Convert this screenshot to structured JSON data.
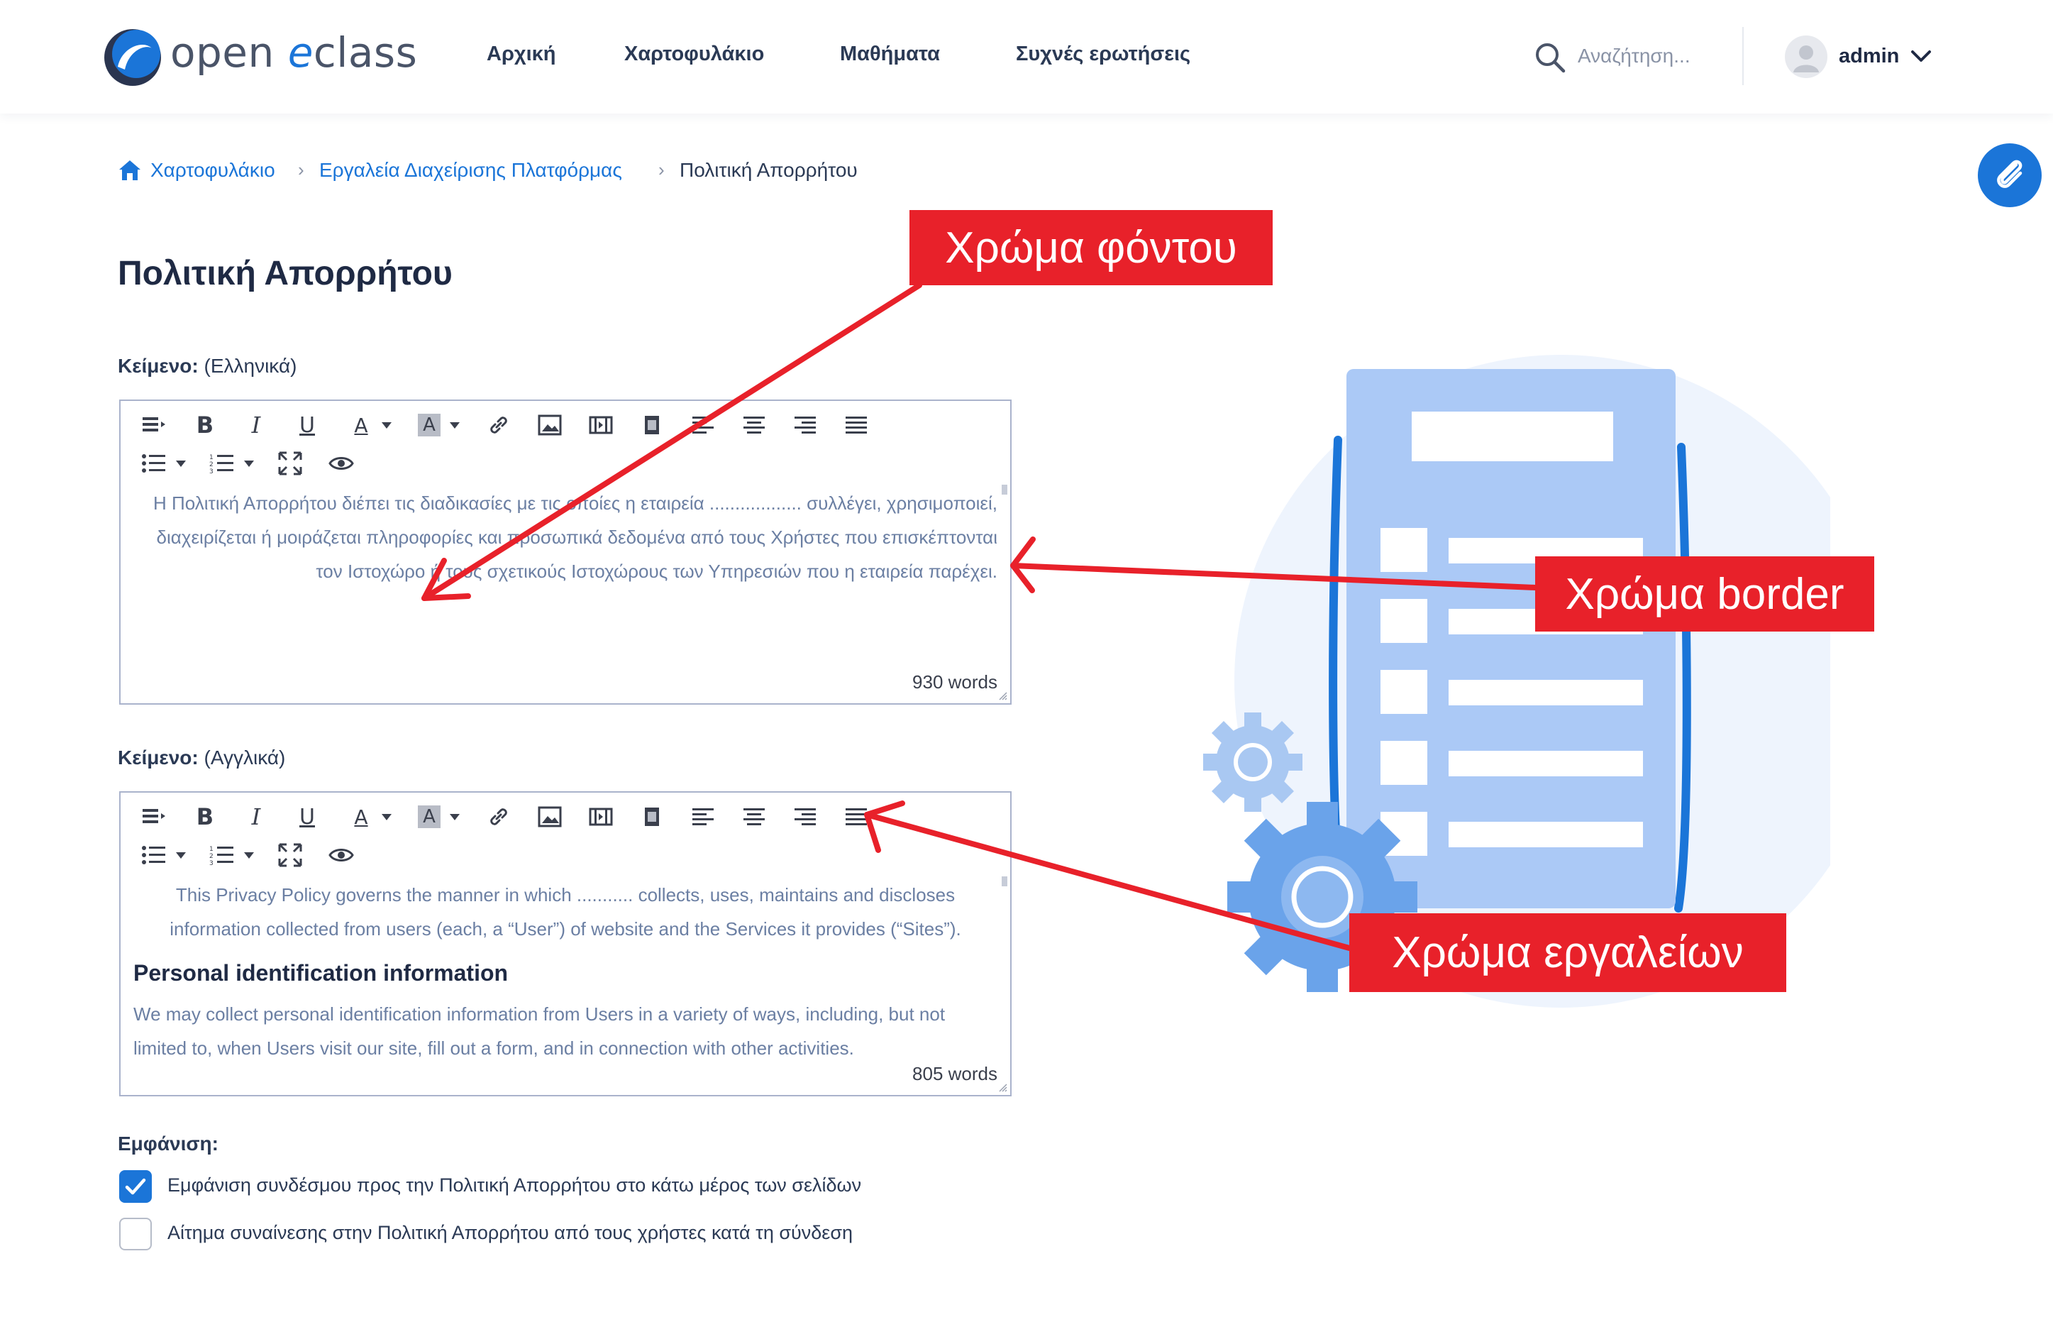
{
  "header": {
    "logo_open": "open ",
    "logo_e": "e",
    "logo_class": "class",
    "nav": [
      "Αρχική",
      "Χαρτοφυλάκιο",
      "Μαθήματα",
      "Συχνές ερωτήσεις"
    ],
    "search_placeholder": "Αναζήτηση...",
    "user": "admin"
  },
  "breadcrumb": [
    "Χαρτοφυλάκιο",
    "Εργαλεία Διαχείρισης Πλατφόρμας",
    "Πολιτική Απορρήτου"
  ],
  "page_title": "Πολιτική Απορρήτου",
  "editors": [
    {
      "label_bold": "Κείμενο:",
      "label_lang": "(Ελληνικά)",
      "content": "Η Πολιτική Απορρήτου διέπει τις διαδικασίες με τις οποίες η εταιρεία .................. συλλέγει, χρησιμοποιεί, διαχειρίζεται ή μοιράζεται πληροφορίες και προσωπικά δεδομένα από τους Χρήστες που επισκέπτονται τον Ιστοχώρο ή τους σχετικούς Ιστοχώρους των Υπηρεσιών που η εταιρεία παρέχει.",
      "word_count": "930 words"
    },
    {
      "label_bold": "Κείμενο:",
      "label_lang": "(Αγγλικά)",
      "content_p1": "This Privacy Policy governs the manner in which ........... collects, uses, maintains and discloses information collected from users (each, a “User”) of website and the Services it provides (“Sites”).",
      "content_heading": "Personal identification information",
      "content_p2": "We may collect personal identification information from Users in a variety of ways, including, but not limited to, when Users visit our site, fill out a form, and in connection with other activities.",
      "word_count": "805 words"
    }
  ],
  "toolbar_icons": [
    "format-icon",
    "bold-icon",
    "italic-icon",
    "underline-icon",
    "text-color-icon",
    "bg-color-icon",
    "link-icon",
    "image-icon",
    "media-icon",
    "video-icon",
    "align-left-icon",
    "align-center-icon",
    "align-right-icon",
    "align-justify-icon",
    "bullet-list-icon",
    "numbered-list-icon",
    "fullscreen-icon",
    "preview-icon"
  ],
  "appearance": {
    "label": "Εμφάνιση:",
    "options": [
      {
        "label": "Εμφάνιση συνδέσμου προς την Πολιτική Απορρήτου στο κάτω μέρος των σελίδων",
        "checked": true
      },
      {
        "label": "Αίτημα συναίνεσης στην Πολιτική Απορρήτου από τους χρήστες κατά τη σύνδεση",
        "checked": false
      }
    ]
  },
  "annotations": [
    "Χρώμα φόντου",
    "Χρώμα border",
    "Χρώμα εργαλείων"
  ],
  "colors": {
    "accent": "#1b75d8",
    "annotation": "#e8212a",
    "editor_text": "#6b7fa3",
    "editor_border": "#aab3cc"
  }
}
